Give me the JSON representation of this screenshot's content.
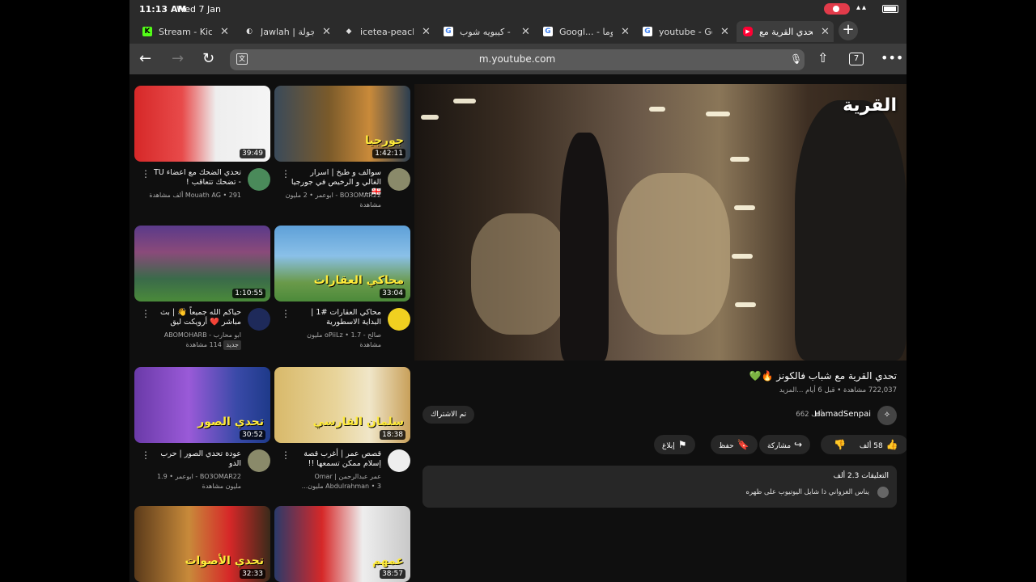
{
  "status": {
    "time": "11:13 AM",
    "date": "Wed 7 Jan",
    "battery_icon": "battery-icon",
    "wifi_icon": "wifi-icon"
  },
  "tabs": [
    {
      "title": "Stream - Kick",
      "favicon": "K",
      "color": "#53fc18"
    },
    {
      "title": "Jawlah | جولة",
      "favicon": "◐",
      "color": "#888888"
    },
    {
      "title": "icetea-peachy",
      "favicon": "◆",
      "color": "#bbbbbb"
    },
    {
      "title": "كيبويه شوب - .",
      "favicon": "G",
      "color": "#ffffff"
    },
    {
      "title": "Googl... - طقوما",
      "favicon": "G",
      "color": "#ffffff"
    },
    {
      "title": "youtube - Goo",
      "favicon": "G",
      "color": "#ffffff"
    },
    {
      "title": "تحدي القرية مع",
      "favicon": "▶",
      "color": "#ff0033"
    }
  ],
  "toolbar": {
    "url": "m.youtube.com",
    "tab_count": "7"
  },
  "feed": [
    {
      "title": "تحدي الضحك مع اعضاء TU - تضحك تتعاقب !",
      "channel": "Mouath AG • 291 ألف مشاهدة",
      "duration": "39:49",
      "thumb_colors": [
        "#d62828",
        "#f3f3f3"
      ]
    },
    {
      "title": "سوالف و طبخ | اسرار الغالي و الرخيص في جورجيا 🇬🇪 ...",
      "channel": "BO3OMAR22 - ابوعمر • 2 مليون مشاهدة",
      "duration": "1:42:11",
      "thumb_text": "جورجيا",
      "thumb_colors": [
        "#7a5a2a",
        "#2c3e50"
      ]
    },
    {
      "title": "حياكم الله جميعاً 👋 | بث مباشر ❤️ أرويكت ليق",
      "channel": "ابو محارب - ABOMOHARB",
      "extra": "114 مشاهدة",
      "badge": "جديد",
      "duration": "1:10:55",
      "thumb_colors": [
        "#3b2a6a",
        "#4a8a3a"
      ]
    },
    {
      "title": "محاكي العقارات #1 | البداية الاسطورية",
      "channel": "صالح - oPiiLz • 1.7 مليون مشاهدة",
      "duration": "33:04",
      "thumb_text": "محاكي العقارات",
      "thumb_colors": [
        "#5ea0d8",
        "#4c8a3a"
      ]
    },
    {
      "title": "عودة تحدي الصور | حرب الدو",
      "channel": "BO3OMAR22 - ابوعمر • 1.9 مليون مشاهدة",
      "duration": "30:52",
      "thumb_text": "تحدي الصور",
      "thumb_colors": [
        "#6a3aa8",
        "#1e3a8a"
      ]
    },
    {
      "title": "قصص عمر | أغرب قصة إسلام ممكن تسمعها !!",
      "channel": "عمر عبدالرحمن | Omar Abdulrahman • 3 مليون...",
      "duration": "18:38",
      "thumb_text": "سلمان الفارسي",
      "thumb_colors": [
        "#d8b96a",
        "#f0e6c8"
      ]
    },
    {
      "title": "",
      "channel": "",
      "duration": "32:33",
      "thumb_text": "تحدي الأصوات",
      "thumb_colors": [
        "#5a3a1a",
        "#d62828"
      ]
    },
    {
      "title": "",
      "channel": "",
      "duration": "38:57",
      "thumb_text": "عمهم",
      "thumb_colors": [
        "#2a3a6a",
        "#c8c8c8"
      ]
    }
  ],
  "player": {
    "watermark": "القرية"
  },
  "video": {
    "title": "تحدي القرية مع شباب فالكونز 🔥💚",
    "meta": "722,037 مشاهدة • قبل 6 أيام ...المزيد",
    "channel": "HamadSenpai",
    "subs": "662 ألف",
    "subscribe_label": "تم الاشتراك",
    "likes": "58 ألف",
    "share": "مشاركة",
    "save": "حفظ",
    "report": "إبلاغ"
  },
  "comments": {
    "header": "التعليقات 2.3 ألف",
    "top_comment": "يناس الغزواني ذا شايل اليوتيوب على ظهره"
  }
}
